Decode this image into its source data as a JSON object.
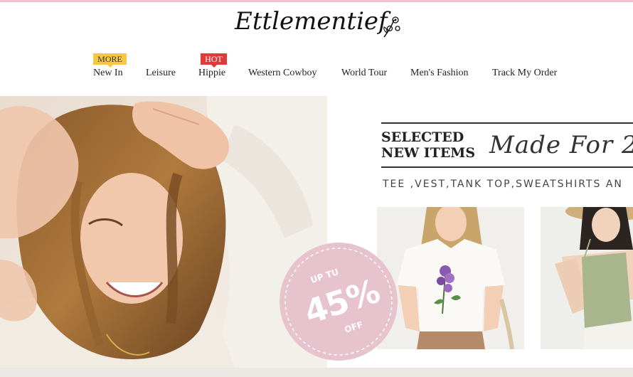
{
  "logo": {
    "text": "Ettlementief"
  },
  "nav": {
    "badges": {
      "more": "MORE",
      "hot": "HOT"
    },
    "items": [
      {
        "label": "New In"
      },
      {
        "label": "Leisure"
      },
      {
        "label": "Hippie"
      },
      {
        "label": "Western Cowboy"
      },
      {
        "label": "World Tour"
      },
      {
        "label": "Men's Fashion"
      },
      {
        "label": "Track My Order"
      }
    ]
  },
  "banner": {
    "selected_line1": "SELECTED",
    "selected_line2": "NEW ITEMS",
    "script_text": "Made For 2",
    "subtitle": "TEE ,VEST,TANK TOP,SWEATSHIRTS AN",
    "discount": {
      "upto": "UP TU",
      "percent": "45%",
      "off": "OFF"
    }
  },
  "colors": {
    "top_strip": "#f2c2d2",
    "badge_more": "#f7c744",
    "badge_hot": "#e03b3b",
    "discount_circle": "#e7c3ce"
  }
}
